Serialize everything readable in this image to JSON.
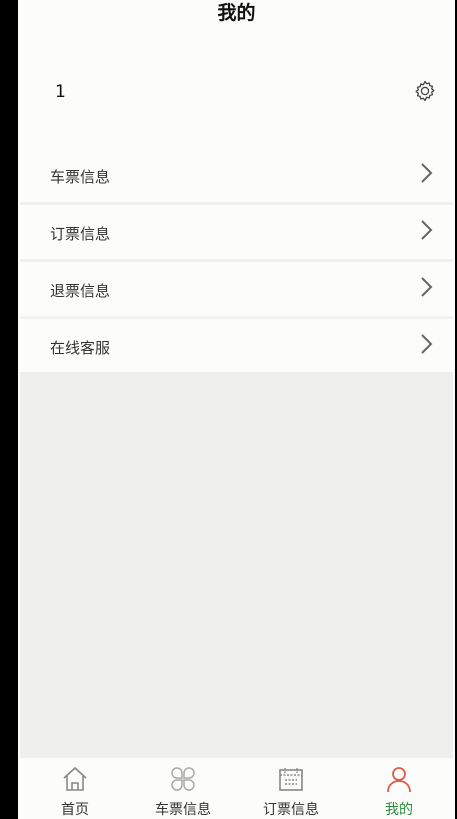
{
  "header": {
    "title": "我的"
  },
  "user": {
    "name": "1",
    "settings_icon": "gear-icon"
  },
  "menu": {
    "items": [
      {
        "label": "车票信息",
        "icon": "chevron-right-icon"
      },
      {
        "label": "订票信息",
        "icon": "chevron-right-icon"
      },
      {
        "label": "退票信息",
        "icon": "chevron-right-icon"
      },
      {
        "label": "在线客服",
        "icon": "chevron-right-icon"
      }
    ]
  },
  "tabbar": {
    "tabs": [
      {
        "label": "首页",
        "icon": "home-icon",
        "active": false
      },
      {
        "label": "车票信息",
        "icon": "grid-icon",
        "active": false
      },
      {
        "label": "订票信息",
        "icon": "calendar-icon",
        "active": false
      },
      {
        "label": "我的",
        "icon": "person-icon",
        "active": true
      }
    ]
  },
  "colors": {
    "active_tab_label": "#2e8a3e",
    "active_tab_icon": "#e05a4a",
    "background": "#efefed"
  }
}
